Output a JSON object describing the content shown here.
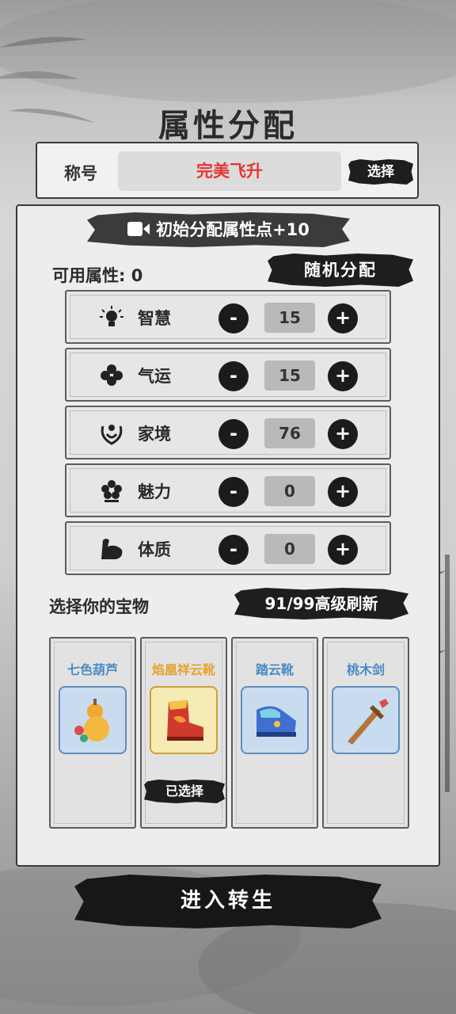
{
  "page": {
    "title": "属性分配"
  },
  "title_section": {
    "label": "称号",
    "value": "完美飞升",
    "select_label": "选择"
  },
  "bonus": {
    "label": "初始分配属性点+10",
    "icon": "video-icon"
  },
  "available": {
    "label": "可用属性: 0",
    "random_label": "随机分配"
  },
  "attributes": [
    {
      "name": "智慧",
      "value": "15",
      "icon": "lightbulb-icon"
    },
    {
      "name": "气运",
      "value": "15",
      "icon": "clover-icon"
    },
    {
      "name": "家境",
      "value": "76",
      "icon": "family-icon"
    },
    {
      "name": "魅力",
      "value": "0",
      "icon": "flower-icon"
    },
    {
      "name": "体质",
      "value": "0",
      "icon": "muscle-icon"
    }
  ],
  "controls": {
    "minus": "-",
    "plus": "+"
  },
  "treasure": {
    "label": "选择你的宝物",
    "refresh_label": "91/99高级刷新",
    "items": [
      {
        "name": "七色葫芦",
        "icon": "gourd-icon",
        "rarity_color": "#4a8ac4"
      },
      {
        "name": "焰凰祥云靴",
        "icon": "red-boots-icon",
        "rarity_color": "#e5a32d",
        "selected_label": "已选择"
      },
      {
        "name": "踏云靴",
        "icon": "blue-boots-icon",
        "rarity_color": "#4a8ac4"
      },
      {
        "name": "桃木剑",
        "icon": "wooden-sword-icon",
        "rarity_color": "#4a8ac4"
      }
    ]
  },
  "enter": {
    "label": "进入转生"
  }
}
